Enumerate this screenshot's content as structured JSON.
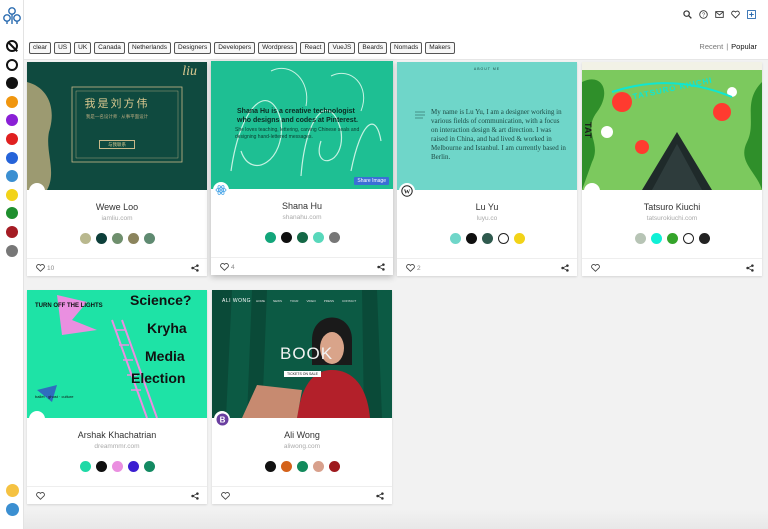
{
  "filters": {
    "tags": [
      "clear",
      "US",
      "UK",
      "Canada",
      "Netherlands",
      "Designers",
      "Developers",
      "Wordpress",
      "React",
      "VueJS",
      "Beards",
      "Nomads",
      "Makers"
    ],
    "sort": {
      "recent": "Recent",
      "separator": "|",
      "popular": "Popular"
    }
  },
  "rail": {
    "colors": [
      "none",
      "#ffffff",
      "#111111",
      "#f0960f",
      "#8a1fd6",
      "#e02020",
      "#2563d9",
      "#3b8fd1",
      "#f2d318",
      "#1e8f2e",
      "#a51c24",
      "#777777"
    ],
    "selected_index": 9
  },
  "top_icons": [
    "search-icon",
    "help-icon",
    "mail-icon",
    "heart-icon",
    "add-icon"
  ],
  "cards": [
    {
      "name": "Wewe Loo",
      "url": "iamliu.com",
      "likes": "10",
      "colors": [
        "#b9b88e",
        "#0d3f3a",
        "#6f8f6d",
        "#8b845d",
        "#5f8a71"
      ],
      "badge": "",
      "shot": {
        "heading": "我是刘方伟",
        "sub": "我是一名设计师 · 从事平面设计",
        "button": "与我联系",
        "corner": "liu"
      }
    },
    {
      "name": "Shana Hu",
      "url": "shanahu.com",
      "likes": "4",
      "colors": [
        "#12a57a",
        "#0f0f0f",
        "#136846",
        "#58d8bb",
        "#777777"
      ],
      "badge": "react",
      "shot": {
        "headline": "Shana Hu is a creative technologist who designs and codes at Pinterest.",
        "body": "She loves teaching, lettering, carving Chinese seals and designing hand-lettered messages.",
        "button": "Share Image"
      }
    },
    {
      "name": "Lu Yu",
      "url": "luyu.co",
      "likes": "2",
      "colors": [
        "#6fd6c9",
        "#0f0f0f",
        "#2f5a4e",
        "#ffffff",
        "#f2d318"
      ],
      "badge": "wordpress",
      "shot": {
        "nav": "ABOUT ME",
        "body": "My name is Lu Yu, I am a designer working in various fields of communication, with a focus on interaction design & art direction. I was raised in China, and had lived & worked in Melbourne and Istanbul. I am currently based in Berlin."
      }
    },
    {
      "name": "Tatsuro Kiuchi",
      "url": "tatsurokiuchi.com",
      "likes": "",
      "colors": [
        "#b7c4b5",
        "#10f0d6",
        "#34a42a",
        "#ffffff",
        "#222222"
      ],
      "badge": "",
      "shot": {
        "title": "TATSURO KIUCHI",
        "side": "TAT"
      }
    },
    {
      "name": "Arshak Khachatrian",
      "url": "dreammmr.com",
      "likes": "",
      "colors": [
        "#1ed9a6",
        "#0f0f0f",
        "#ea8fe0",
        "#3b1ed1",
        "#138a62"
      ],
      "badge": "",
      "shot": {
        "top": "TURN OFF THE LIGHTS",
        "l1": "Science?",
        "l2": "Kryha",
        "l3": "Media",
        "l4": "Election",
        "foot": "ballet · ghost · culture"
      }
    },
    {
      "name": "Ali Wong",
      "url": "aliwong.com",
      "likes": "",
      "colors": [
        "#111111",
        "#d4621a",
        "#128a5c",
        "#d8a08c",
        "#9e1a1e"
      ],
      "badge": "bootstrap",
      "shot": {
        "brand": "ALI WONG",
        "nav": [
          "HOME",
          "NEWS",
          "TOUR",
          "VIDEO",
          "PRESS",
          "CONTACT"
        ],
        "word": "BOOK",
        "cta": "TICKETS ON SALE"
      }
    }
  ]
}
